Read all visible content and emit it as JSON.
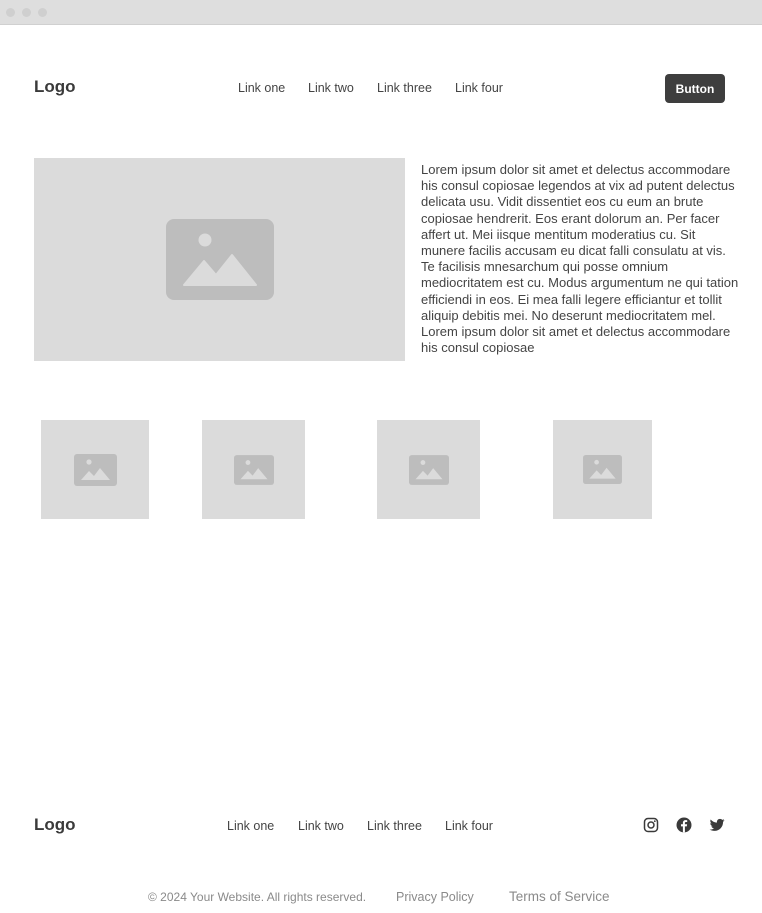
{
  "header": {
    "logo": "Logo",
    "nav": [
      "Link one",
      "Link two",
      "Link three",
      "Link four"
    ],
    "button_label": "Button"
  },
  "hero": {
    "image_icon": "image-placeholder-icon",
    "text": "Lorem ipsum dolor sit amet et delectus accommodare his consul copiosae legendos at vix ad putent delectus delicata usu. Vidit dissentiet eos cu eum an brute copiosae hendrerit. Eos erant dolorum an. Per facer affert ut. Mei iisque mentitum moderatius cu. Sit munere facilis accusam eu dicat falli consulatu at vis. Te facilisis mnesarchum qui posse omnium mediocritatem est cu. Modus argumentum ne qui tation efficiendi in eos. Ei mea falli legere efficiantur et tollit aliquip debitis mei. No deserunt mediocritatem mel. Lorem ipsum dolor sit amet et delectus accommodare his consul copiosae"
  },
  "gallery": {
    "icon": "image-placeholder-icon",
    "count_label": ""
  },
  "footer": {
    "logo": "Logo",
    "nav": [
      "Link one",
      "Link two",
      "Link three",
      "Link four"
    ],
    "social_icons": [
      "instagram-icon",
      "facebook-icon",
      "twitter-icon"
    ],
    "copyright": "© 2024 Your Website. All rights reserved.",
    "privacy": "Privacy Policy",
    "terms": "Terms of Service"
  },
  "colors": {
    "placeholder_bg": "#dbdbdb",
    "placeholder_icon": "#bdbdbd",
    "button_bg": "#3e3e3e",
    "text": "#3a3a3a"
  }
}
